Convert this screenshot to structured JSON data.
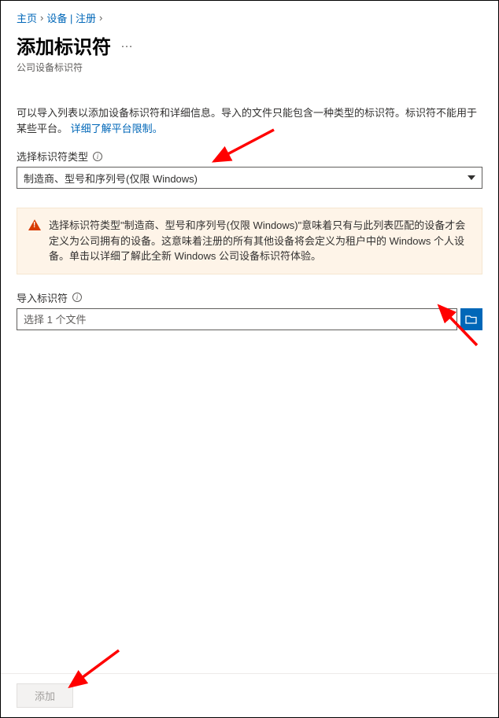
{
  "breadcrumb": {
    "home": "主页",
    "devices": "设备 | 注册"
  },
  "page": {
    "title": "添加标识符",
    "ellipsis": "…",
    "subtitle": "公司设备标识符"
  },
  "description": {
    "text": "可以导入列表以添加设备标识符和详细信息。导入的文件只能包含一种类型的标识符。标识符不能用于某些平台。",
    "link": "详细了解平台限制。"
  },
  "identifier_type": {
    "label": "选择标识符类型",
    "value": "制造商、型号和序列号(仅限 Windows)"
  },
  "warning": {
    "text": "选择标识符类型\"制造商、型号和序列号(仅限 Windows)\"意味着只有与此列表匹配的设备才会定义为公司拥有的设备。这意味着注册的所有其他设备将会定义为租户中的 Windows 个人设备。单击以详细了解此全新 Windows 公司设备标识符体验。"
  },
  "import": {
    "label": "导入标识符",
    "placeholder": "选择 1 个文件"
  },
  "footer": {
    "add": "添加"
  }
}
